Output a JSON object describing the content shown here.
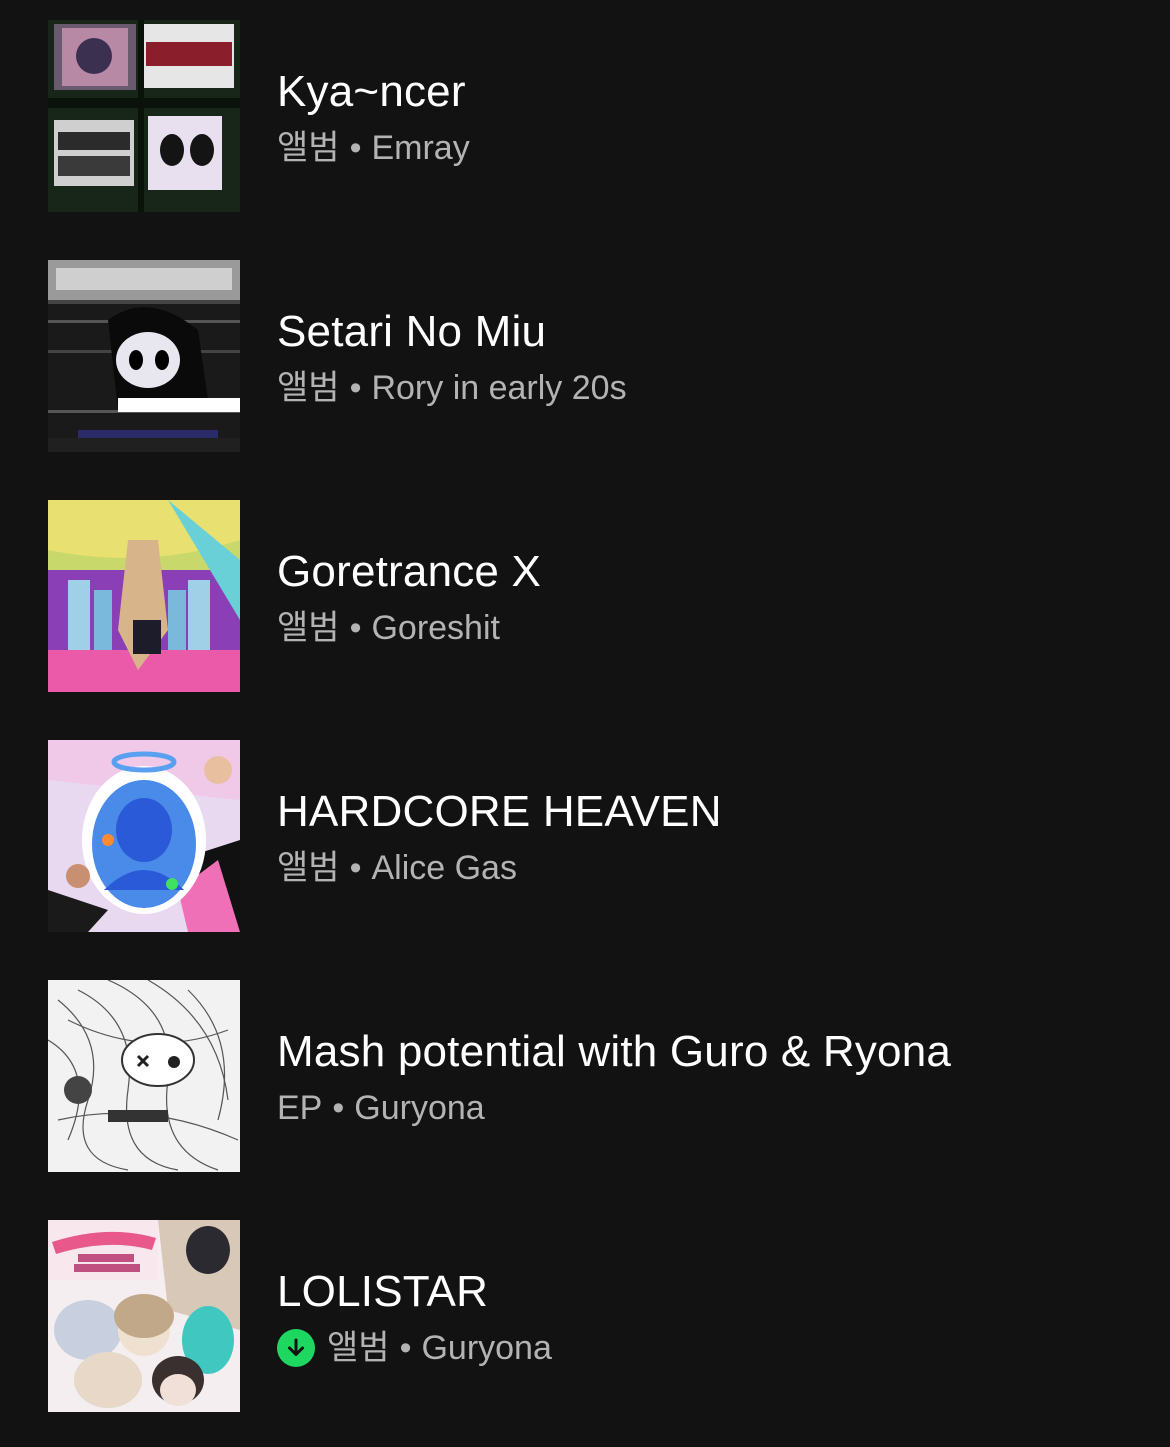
{
  "items": [
    {
      "title": "Kya~ncer",
      "type": "앨범",
      "artist": "Emray",
      "downloaded": false,
      "cover_icon": "album-cover-kyancer"
    },
    {
      "title": "Setari No Miu",
      "type": "앨범",
      "artist": "Rory in early 20s",
      "downloaded": false,
      "cover_icon": "album-cover-setari-no-miu"
    },
    {
      "title": "Goretrance X",
      "type": "앨범",
      "artist": "Goreshit",
      "downloaded": false,
      "cover_icon": "album-cover-goretrance-x"
    },
    {
      "title": "HARDCORE HEAVEN",
      "type": "앨범",
      "artist": "Alice Gas",
      "downloaded": false,
      "cover_icon": "album-cover-hardcore-heaven"
    },
    {
      "title": "Mash potential with Guro & Ryona",
      "type": "EP",
      "artist": "Guryona",
      "downloaded": false,
      "cover_icon": "album-cover-mash-potential"
    },
    {
      "title": "LOLISTAR",
      "type": "앨범",
      "artist": "Guryona",
      "downloaded": true,
      "cover_icon": "album-cover-lolistar"
    }
  ],
  "separator": "•",
  "colors": {
    "background": "#121212",
    "title": "#ffffff",
    "subtitle": "#b3b3b3",
    "download_accent": "#1ed760"
  }
}
